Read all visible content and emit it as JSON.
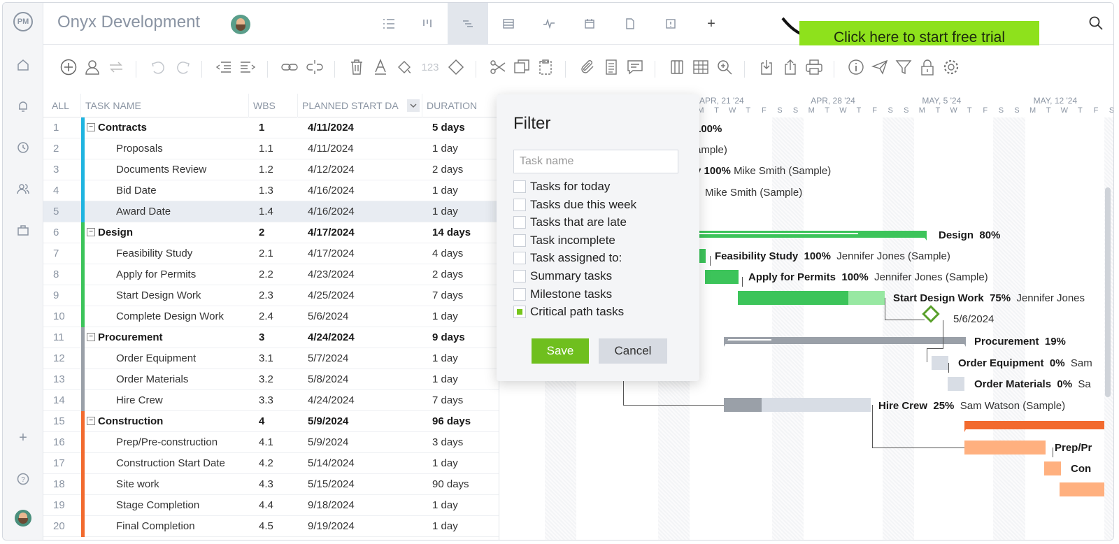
{
  "app": {
    "logo": "PM",
    "project_title": "Onyx Development"
  },
  "cta": {
    "label": "Click here to start free trial"
  },
  "grid": {
    "headers": {
      "all": "ALL",
      "task_name": "TASK NAME",
      "wbs": "WBS",
      "planned_start": "PLANNED START DA",
      "duration": "DURATION"
    },
    "rows": [
      {
        "num": "1",
        "name": "Contracts",
        "wbs": "1",
        "start": "4/11/2024",
        "duration": "5 days",
        "summary": true,
        "color": "#1fb4e0"
      },
      {
        "num": "2",
        "name": "Proposals",
        "wbs": "1.1",
        "start": "4/11/2024",
        "duration": "1 day",
        "summary": false,
        "color": "#1fb4e0"
      },
      {
        "num": "3",
        "name": "Documents Review",
        "wbs": "1.2",
        "start": "4/12/2024",
        "duration": "2 days",
        "summary": false,
        "color": "#1fb4e0"
      },
      {
        "num": "4",
        "name": "Bid Date",
        "wbs": "1.3",
        "start": "4/16/2024",
        "duration": "1 day",
        "summary": false,
        "color": "#1fb4e0"
      },
      {
        "num": "5",
        "name": "Award Date",
        "wbs": "1.4",
        "start": "4/16/2024",
        "duration": "1 day",
        "summary": false,
        "color": "#1fb4e0"
      },
      {
        "num": "6",
        "name": "Design",
        "wbs": "2",
        "start": "4/17/2024",
        "duration": "14 days",
        "summary": true,
        "color": "#3cc45a"
      },
      {
        "num": "7",
        "name": "Feasibility Study",
        "wbs": "2.1",
        "start": "4/17/2024",
        "duration": "4 days",
        "summary": false,
        "color": "#3cc45a"
      },
      {
        "num": "8",
        "name": "Apply for Permits",
        "wbs": "2.2",
        "start": "4/23/2024",
        "duration": "2 days",
        "summary": false,
        "color": "#3cc45a"
      },
      {
        "num": "9",
        "name": "Start Design Work",
        "wbs": "2.3",
        "start": "4/25/2024",
        "duration": "7 days",
        "summary": false,
        "color": "#3cc45a"
      },
      {
        "num": "10",
        "name": "Complete Design Work",
        "wbs": "2.4",
        "start": "5/6/2024",
        "duration": "1 day",
        "summary": false,
        "color": "#3cc45a"
      },
      {
        "num": "11",
        "name": "Procurement",
        "wbs": "3",
        "start": "4/24/2024",
        "duration": "9 days",
        "summary": true,
        "color": "#9aa0a8"
      },
      {
        "num": "12",
        "name": "Order Equipment",
        "wbs": "3.1",
        "start": "5/7/2024",
        "duration": "1 day",
        "summary": false,
        "color": "#9aa0a8"
      },
      {
        "num": "13",
        "name": "Order Materials",
        "wbs": "3.2",
        "start": "5/8/2024",
        "duration": "1 day",
        "summary": false,
        "color": "#9aa0a8"
      },
      {
        "num": "14",
        "name": "Hire Crew",
        "wbs": "3.3",
        "start": "4/24/2024",
        "duration": "7 days",
        "summary": false,
        "color": "#9aa0a8"
      },
      {
        "num": "15",
        "name": "Construction",
        "wbs": "4",
        "start": "5/9/2024",
        "duration": "96 days",
        "summary": true,
        "color": "#f26a2e"
      },
      {
        "num": "16",
        "name": "Prep/Pre-construction",
        "wbs": "4.1",
        "start": "5/9/2024",
        "duration": "3 days",
        "summary": false,
        "color": "#f26a2e"
      },
      {
        "num": "17",
        "name": "Construction Start Date",
        "wbs": "4.2",
        "start": "5/14/2024",
        "duration": "1 day",
        "summary": false,
        "color": "#f26a2e"
      },
      {
        "num": "18",
        "name": "Site work",
        "wbs": "4.3",
        "start": "5/15/2024",
        "duration": "90 days",
        "summary": false,
        "color": "#f26a2e"
      },
      {
        "num": "19",
        "name": "Stage Completion",
        "wbs": "4.4",
        "start": "9/18/2024",
        "duration": "1 day",
        "summary": false,
        "color": "#f26a2e"
      },
      {
        "num": "20",
        "name": "Final Completion",
        "wbs": "4.5",
        "start": "9/19/2024",
        "duration": "1 day",
        "summary": false,
        "color": "#f26a2e"
      }
    ]
  },
  "timeline": {
    "weeks": [
      "APR, 21 '24",
      "APR, 28 '24",
      "MAY, 5 '24",
      "MAY, 12 '24"
    ],
    "days": [
      "M",
      "T",
      "W",
      "T",
      "F",
      "S",
      "S",
      "M",
      "T",
      "W",
      "T",
      "F",
      "S",
      "S",
      "M",
      "T",
      "W",
      "T",
      "F",
      "S",
      "S",
      "M",
      "T",
      "W",
      "T",
      "F",
      "S",
      "S",
      "M",
      "T",
      "W"
    ],
    "labels": {
      "contracts_pct": "100%",
      "r2_fragment": "ample)",
      "r3_frag": "v",
      "r3_pct": "100%",
      "r3_owner": "Mike Smith (Sample)",
      "r4_owner": "Mike Smith (Sample)",
      "design": "Design",
      "design_pct": "80%",
      "feas": "Feasibility Study",
      "feas_pct": "100%",
      "feas_owner": "Jennifer Jones (Sample)",
      "permits": "Apply for Permits",
      "permits_pct": "100%",
      "permits_owner": "Jennifer Jones (Sample)",
      "sdw": "Start Design Work",
      "sdw_pct": "75%",
      "sdw_owner": "Jennifer Jones",
      "milestone_date": "5/6/2024",
      "proc": "Procurement",
      "proc_pct": "19%",
      "equip": "Order Equipment",
      "equip_pct": "0%",
      "equip_owner": "Sam",
      "mat": "Order Materials",
      "mat_pct": "0%",
      "mat_owner": "Sa",
      "crew": "Hire Crew",
      "crew_pct": "25%",
      "crew_owner": "Sam Watson (Sample)",
      "prep": "Prep/Pr",
      "con": "Con"
    }
  },
  "filter": {
    "title": "Filter",
    "placeholder": "Task name",
    "options": [
      {
        "label": "Tasks for today",
        "checked": false
      },
      {
        "label": "Tasks due this week",
        "checked": false
      },
      {
        "label": "Tasks that are late",
        "checked": false
      },
      {
        "label": "Task incomplete",
        "checked": false
      },
      {
        "label": "Task assigned to:",
        "checked": false
      },
      {
        "label": "Summary tasks",
        "checked": false
      },
      {
        "label": "Milestone tasks",
        "checked": false
      },
      {
        "label": "Critical path tasks",
        "checked": true
      }
    ],
    "save": "Save",
    "cancel": "Cancel"
  },
  "toolbar": {
    "number_format": "123"
  }
}
